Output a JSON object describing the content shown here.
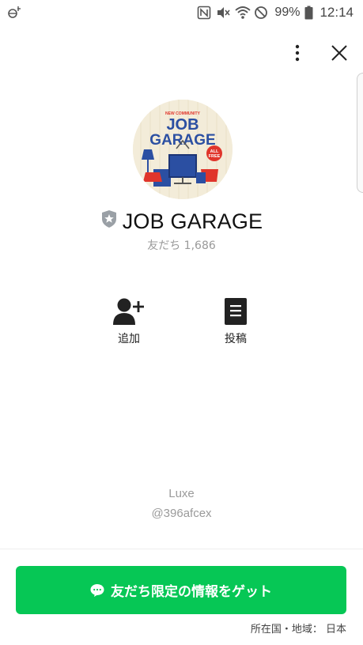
{
  "status_bar": {
    "battery_percent": "99%",
    "clock": "12:14",
    "icons": [
      "sync-icon",
      "nfc-icon",
      "mute-icon",
      "wifi-icon",
      "do-not-disturb-icon",
      "battery-icon"
    ]
  },
  "header": {
    "more_icon": "more-vertical-icon",
    "close_icon": "close-icon"
  },
  "profile": {
    "account_name": "JOB GARAGE",
    "friends_text": "友だち 1,686",
    "badge_icon": "verified-shield-icon",
    "logo_text": {
      "top": "NEW COMMUNITY",
      "line1": "JOB",
      "line2": "GARAGE",
      "tag_line1": "ALL",
      "tag_line2": "FREE"
    }
  },
  "actions": [
    {
      "label": "追加",
      "icon": "add-friend-icon"
    },
    {
      "label": "投稿",
      "icon": "posts-icon"
    }
  ],
  "footer": {
    "display_name": "Luxe",
    "line_id": "@396afcex",
    "cta_label": "友だち限定の情報をゲット",
    "region_label": "所在国・地域： 日本"
  },
  "colors": {
    "cta_green": "#06c755",
    "logo_blue": "#2b4fa2",
    "logo_red": "#e0352b",
    "logo_bg": "#f3ecd9"
  }
}
